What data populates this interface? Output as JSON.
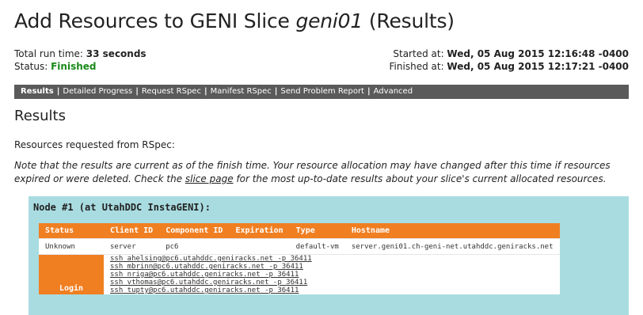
{
  "title": {
    "prefix": "Add Resources to GENI Slice ",
    "slice": "geni01",
    "suffix": " (Results)"
  },
  "run": {
    "total_label": "Total run time: ",
    "total_value": "33 seconds",
    "status_label": "Status: ",
    "status_value": "Finished",
    "started_label": "Started at: ",
    "started_value": "Wed, 05 Aug 2015 12:16:48 -0400",
    "finished_label": "Finished at: ",
    "finished_value": "Wed, 05 Aug 2015 12:17:21 -0400"
  },
  "tabs": [
    {
      "label": "Results"
    },
    {
      "label": "Detailed Progress"
    },
    {
      "label": "Request RSpec"
    },
    {
      "label": "Manifest RSpec"
    },
    {
      "label": "Send Problem Report"
    },
    {
      "label": "Advanced"
    }
  ],
  "results_heading": "Results",
  "requested_text": "Resources requested from RSpec:",
  "note": {
    "part1": "Note that the results are current as of the finish time. Your resource allocation may have changed after this time if resources expired or were deleted. Check the ",
    "link": "slice page",
    "part2": " for the most up-to-date results about your slice's current allocated resources."
  },
  "node": {
    "title": "Node #1 (at UtahDDC InstaGENI):",
    "headers": [
      "Status",
      "Client ID",
      "Component ID",
      "Expiration",
      "Type",
      "Hostname"
    ],
    "row": {
      "status": "Unknown",
      "client_id": "server",
      "component_id": "pc6",
      "expiration": "",
      "type": "default-vm",
      "hostname": "server.geni01.ch-geni-net.utahddc.geniracks.net"
    },
    "login_label": "Login",
    "ssh": [
      "ssh ahelsing@pc6.utahddc.geniracks.net -p 36411",
      "ssh mbrinn@pc6.utahddc.geniracks.net -p 36411",
      "ssh nriga@pc6.utahddc.geniracks.net -p 36411",
      "ssh vthomas@pc6.utahddc.geniracks.net -p 36411",
      "ssh tupty@pc6.utahddc.geniracks.net -p 36411"
    ]
  }
}
